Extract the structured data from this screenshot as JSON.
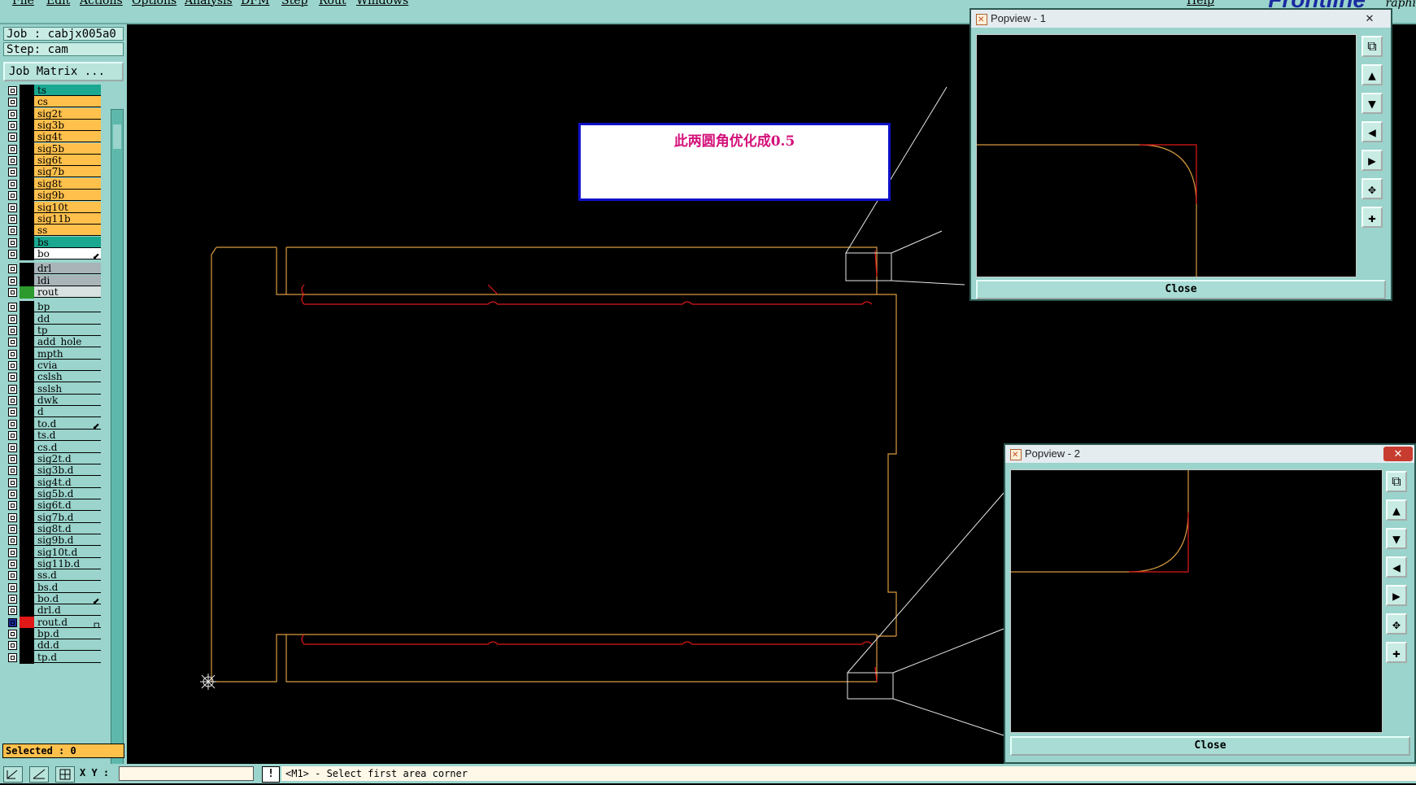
{
  "menubar": {
    "items": [
      "File",
      "Edit",
      "Actions",
      "Options",
      "Analysis",
      "DFM",
      "Step",
      "Rout",
      "Windows"
    ],
    "help": "Help",
    "logo": "Frontline",
    "logo_tail": "raphi"
  },
  "job": {
    "job_line": "Job : cabjx005a0",
    "step_line": "Step: cam",
    "matrix_button": "Job Matrix ..."
  },
  "layers": [
    {
      "name": "ts",
      "color": "#1aa890"
    },
    {
      "name": "cs",
      "color": "#ffc04c"
    },
    {
      "name": "sig2t",
      "color": "#ffc04c"
    },
    {
      "name": "sig3b",
      "color": "#ffc04c"
    },
    {
      "name": "sig4t",
      "color": "#ffc04c"
    },
    {
      "name": "sig5b",
      "color": "#ffc04c"
    },
    {
      "name": "sig6t",
      "color": "#ffc04c"
    },
    {
      "name": "sig7b",
      "color": "#ffc04c"
    },
    {
      "name": "sig8t",
      "color": "#ffc04c"
    },
    {
      "name": "sig9b",
      "color": "#ffc04c"
    },
    {
      "name": "sig10t",
      "color": "#ffc04c"
    },
    {
      "name": "sig11b",
      "color": "#ffc04c"
    },
    {
      "name": "ss",
      "color": "#ffc04c"
    },
    {
      "name": "bs",
      "color": "#1aa890"
    },
    {
      "name": "bo",
      "color": "#ffffff",
      "mark": "⬋"
    },
    {
      "sep": true
    },
    {
      "name": "drl",
      "color": "#a8b4b8"
    },
    {
      "name": "ldi",
      "color": "#a8b4b8"
    },
    {
      "name": "rout",
      "color": "#d8e0e0",
      "swatch": "#2c9a2c"
    },
    {
      "sep": true
    },
    {
      "name": "bp",
      "color": "#9ad4cc"
    },
    {
      "name": "dd",
      "color": "#9ad4cc"
    },
    {
      "name": "tp",
      "color": "#9ad4cc"
    },
    {
      "name": "add_hole",
      "color": "#9ad4cc"
    },
    {
      "name": "mpth",
      "color": "#9ad4cc"
    },
    {
      "name": "cvia",
      "color": "#9ad4cc"
    },
    {
      "name": "cslsh",
      "color": "#9ad4cc"
    },
    {
      "name": "sslsh",
      "color": "#9ad4cc"
    },
    {
      "name": "dwk",
      "color": "#9ad4cc"
    },
    {
      "name": "d",
      "color": "#9ad4cc"
    },
    {
      "name": "to.d",
      "color": "#9ad4cc",
      "mark": "⬋"
    },
    {
      "name": "ts.d",
      "color": "#9ad4cc"
    },
    {
      "name": "cs.d",
      "color": "#9ad4cc"
    },
    {
      "name": "sig2t.d",
      "color": "#9ad4cc"
    },
    {
      "name": "sig3b.d",
      "color": "#9ad4cc"
    },
    {
      "name": "sig4t.d",
      "color": "#9ad4cc"
    },
    {
      "name": "sig5b.d",
      "color": "#9ad4cc"
    },
    {
      "name": "sig6t.d",
      "color": "#9ad4cc"
    },
    {
      "name": "sig7b.d",
      "color": "#9ad4cc"
    },
    {
      "name": "sig8t.d",
      "color": "#9ad4cc"
    },
    {
      "name": "sig9b.d",
      "color": "#9ad4cc"
    },
    {
      "name": "sig10t.d",
      "color": "#9ad4cc"
    },
    {
      "name": "sig11b.d",
      "color": "#9ad4cc"
    },
    {
      "name": "ss.d",
      "color": "#9ad4cc"
    },
    {
      "name": "bs.d",
      "color": "#9ad4cc"
    },
    {
      "name": "bo.d",
      "color": "#9ad4cc",
      "mark": "⬋"
    },
    {
      "name": "drl.d",
      "color": "#9ad4cc"
    },
    {
      "name": "rout.d",
      "color": "#9ad4cc",
      "swatch": "#e01818",
      "active": true,
      "mark": "▫"
    },
    {
      "name": "bp.d",
      "color": "#9ad4cc"
    },
    {
      "name": "dd.d",
      "color": "#9ad4cc"
    },
    {
      "name": "tp.d",
      "color": "#9ad4cc"
    }
  ],
  "selected": "Selected : 0",
  "status": {
    "xy_label": "X Y :",
    "xy_value": "",
    "warn": "!",
    "prompt": "<M1> - Select first area corner"
  },
  "annotation": "此两圆角优化成0.5",
  "popview1": {
    "title": "Popview - 1",
    "close": "Close"
  },
  "popview2": {
    "title": "Popview - 2",
    "close": "Close"
  },
  "colors": {
    "outline": "#d89a40",
    "rout": "#e01818",
    "arc": "#5c9a2c",
    "panel": "#9ad4cc"
  }
}
